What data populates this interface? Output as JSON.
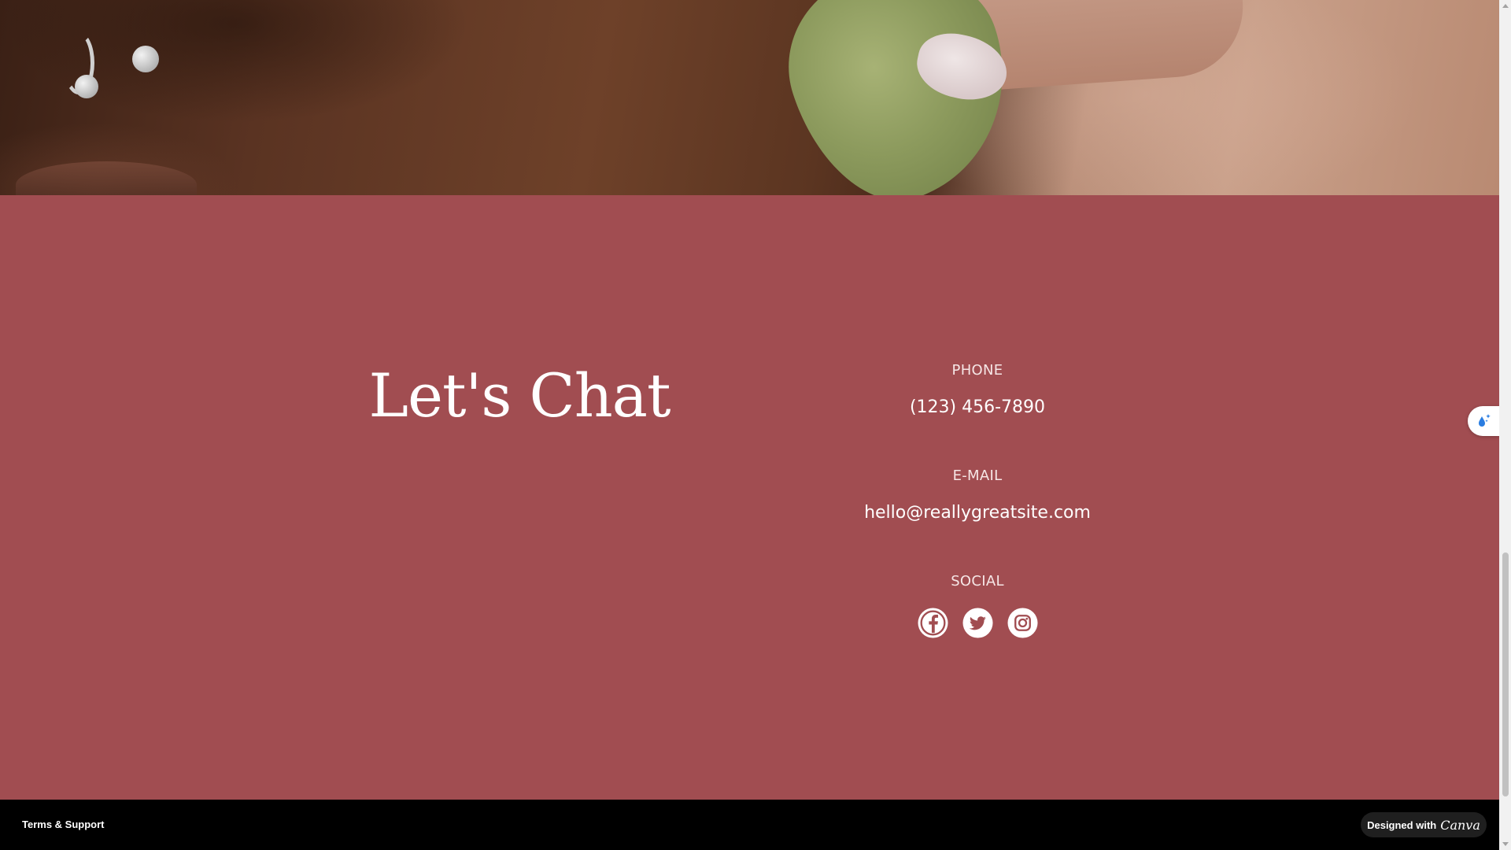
{
  "contact": {
    "headline": "Let's Chat",
    "phone_label": "PHONE",
    "phone_value": "(123) 456-7890",
    "email_label": "E-MAIL",
    "email_value": "hello@reallygreatsite.com",
    "social_label": "SOCIAL",
    "social_icons": [
      "facebook-icon",
      "twitter-icon",
      "instagram-icon"
    ],
    "background_color": "#a14d51"
  },
  "footer": {
    "terms_label": "Terms & Support",
    "badge_prefix": "Designed with",
    "badge_brand": "Canva"
  },
  "widget": {
    "icon": "water-drop-sparkle-icon"
  }
}
